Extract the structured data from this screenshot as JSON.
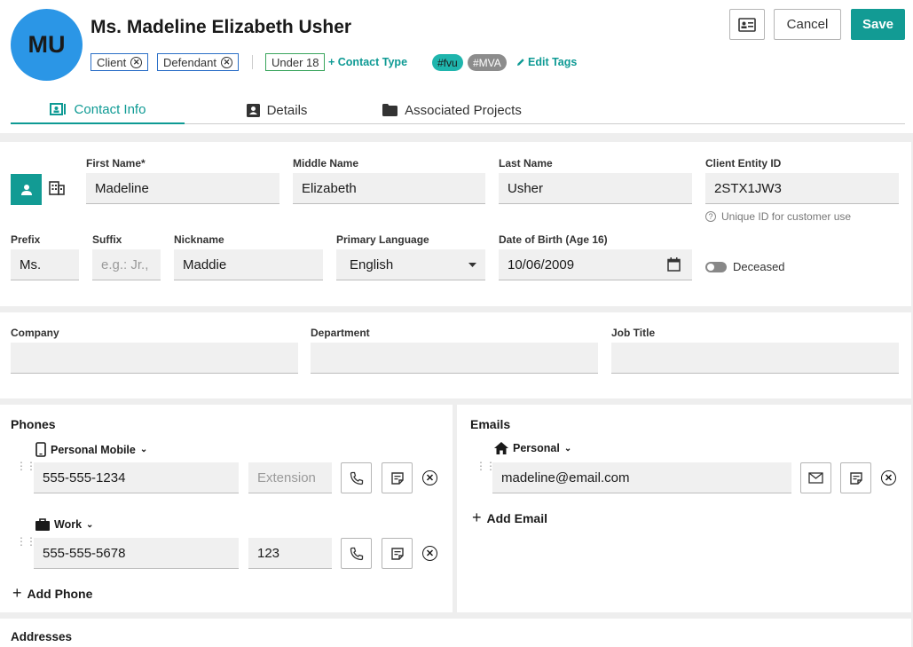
{
  "contact": {
    "initials": "MU",
    "name": "Ms. Madeline Elizabeth Usher",
    "chips": [
      "Client",
      "Defendant"
    ],
    "age_chip": "Under 18",
    "contact_type_link": "+ Contact Type",
    "tags": [
      "#fvu",
      "#MVA"
    ],
    "edit_tags_link": "Edit Tags"
  },
  "actions": {
    "cancel": "Cancel",
    "save": "Save"
  },
  "tabs": [
    "Contact Info",
    "Details",
    "Associated Projects"
  ],
  "name_fields": {
    "first_label": "First Name*",
    "first_value": "Madeline",
    "middle_label": "Middle Name",
    "middle_value": "Elizabeth",
    "last_label": "Last Name",
    "last_value": "Usher",
    "entity_label": "Client Entity ID",
    "entity_value": "2STX1JW3",
    "entity_help": "Unique ID for customer use"
  },
  "personal_fields": {
    "prefix_label": "Prefix",
    "prefix_value": "Ms.",
    "suffix_label": "Suffix",
    "suffix_placeholder": "e.g.: Jr.,",
    "nickname_label": "Nickname",
    "nickname_value": "Maddie",
    "language_label": "Primary Language",
    "language_value": "English",
    "dob_label": "Date of Birth (Age 16)",
    "dob_value": "10/06/2009",
    "deceased_label": "Deceased"
  },
  "work_fields": {
    "company_label": "Company",
    "department_label": "Department",
    "job_title_label": "Job Title"
  },
  "phones": {
    "title": "Phones",
    "entries": [
      {
        "kind": "Personal Mobile",
        "number": "555-555-1234",
        "extension": "",
        "extension_placeholder": "Extension"
      },
      {
        "kind": "Work",
        "number": "555-555-5678",
        "extension": "123",
        "extension_placeholder": "Extension"
      }
    ],
    "add_label": "Add Phone"
  },
  "emails": {
    "title": "Emails",
    "entries": [
      {
        "kind": "Personal",
        "address": "madeline@email.com"
      }
    ],
    "add_label": "Add Email"
  },
  "addresses": {
    "title": "Addresses"
  },
  "colors": {
    "accent": "#129b94",
    "avatar": "#2b96e6",
    "tag_fvu": "#1fb5ad",
    "tag_mva": "#8c8c8c"
  }
}
